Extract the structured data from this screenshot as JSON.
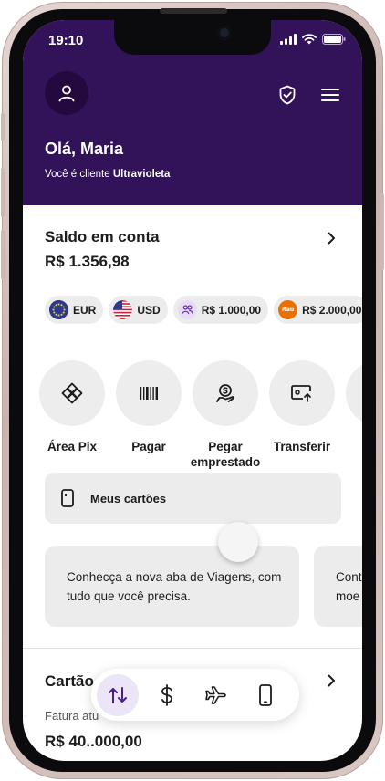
{
  "status_bar": {
    "time": "19:10"
  },
  "header": {
    "greeting": "Olá, Maria",
    "client_prefix": "Você é cliente ",
    "client_tier": "Ultravioleta"
  },
  "balance": {
    "title": "Saldo em conta",
    "value": "R$ 1.356,98"
  },
  "currencies": [
    {
      "label": "EUR",
      "icon": "eu-flag-icon"
    },
    {
      "label": "USD",
      "icon": "us-flag-icon"
    },
    {
      "label": "R$ 1.000,00",
      "icon": "people-icon"
    },
    {
      "label": "R$ 2.000,00",
      "icon": "itau-logo-icon"
    }
  ],
  "actions": [
    {
      "label": "Área Pix",
      "icon": "pix-icon"
    },
    {
      "label": "Pagar",
      "icon": "barcode-icon"
    },
    {
      "label": "Pegar emprestado",
      "icon": "loan-hand-icon"
    },
    {
      "label": "Transferir",
      "icon": "transfer-icon"
    }
  ],
  "cards_button": {
    "label": "Meus cartões"
  },
  "promos": [
    {
      "text": "Conhecça a nova aba de Viagens, com tudo que você precisa."
    },
    {
      "text": "Cont moe"
    }
  ],
  "credit_card": {
    "title": "Cartão",
    "invoice_label": "Fatura atu",
    "invoice_value": "R$ 40..000,00"
  },
  "bottom_nav": [
    "transfer-arrows-icon",
    "dollar-icon",
    "airplane-icon",
    "phone-icon"
  ],
  "colors": {
    "header_bg": "#321258",
    "accent": "#6b2fb3",
    "surface": "#ececec",
    "nav_active_bg": "#ece4f7"
  }
}
